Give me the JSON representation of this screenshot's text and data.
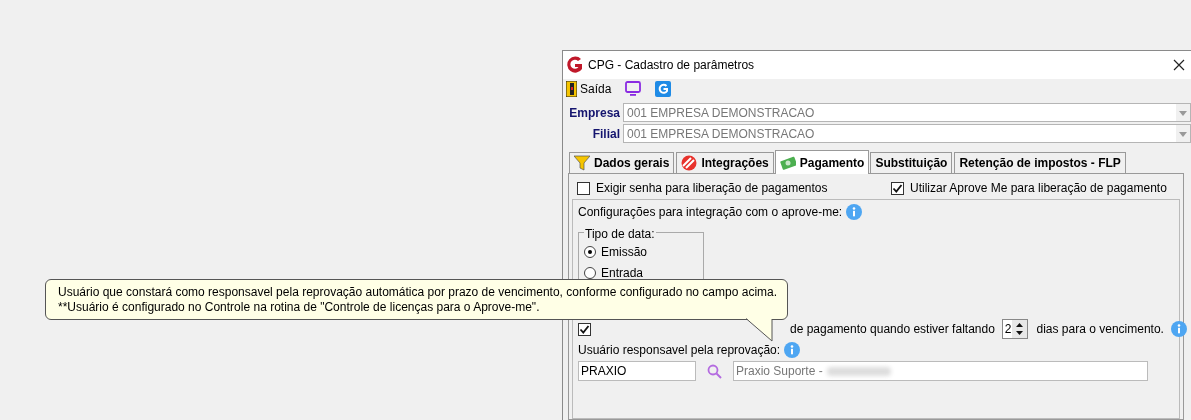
{
  "window": {
    "title": "CPG - Cadastro de parâmetros"
  },
  "toolbar": [
    {
      "kind": "exit",
      "label": "Saída"
    },
    {
      "kind": "monitor"
    },
    {
      "kind": "logo"
    }
  ],
  "fields": [
    {
      "label": "Empresa",
      "value": "001 EMPRESA DEMONSTRACAO"
    },
    {
      "label": "Filial",
      "value": "001 EMPRESA DEMONSTRACAO"
    }
  ],
  "tabs": [
    {
      "label": "Dados gerais",
      "kind": "filter",
      "selected": false
    },
    {
      "label": "Integrações",
      "kind": "stripes",
      "selected": false
    },
    {
      "label": "Pagamento",
      "kind": "money",
      "selected": true
    },
    {
      "label": "Substituição",
      "kind": "plain",
      "selected": false
    },
    {
      "label": "Retenção de impostos - FLP",
      "kind": "plain",
      "selected": false
    }
  ],
  "options": [
    {
      "label": "Exigir senha para liberação de pagamentos",
      "checked": false
    },
    {
      "label": "Utilizar Aprove Me para liberação de pagamento",
      "checked": true
    }
  ],
  "integration": {
    "title": "Configurações para integração com o aprove-me:",
    "date_type": {
      "title": "Tipo de data:",
      "options": [
        {
          "label": "Emissão",
          "selected": true
        },
        {
          "label": "Entrada",
          "selected": false
        }
      ]
    },
    "auto_reject": {
      "checked": true,
      "label": "de pagamento quando estiver faltando",
      "days": "2",
      "suffix": "dias para o vencimento."
    },
    "user": {
      "label": "Usuário responsavel pela reprovação:",
      "code": "PRAXIO",
      "name": "Praxio Suporte -"
    }
  },
  "tooltip": {
    "lines": [
      "Usuário que constará como responsavel pela reprovação automática por prazo de vencimento, conforme configurado no campo acima.",
      "**Usuário é configurado no Controle na rotina de \"Controle de licenças para o Aprove-me\"."
    ]
  }
}
